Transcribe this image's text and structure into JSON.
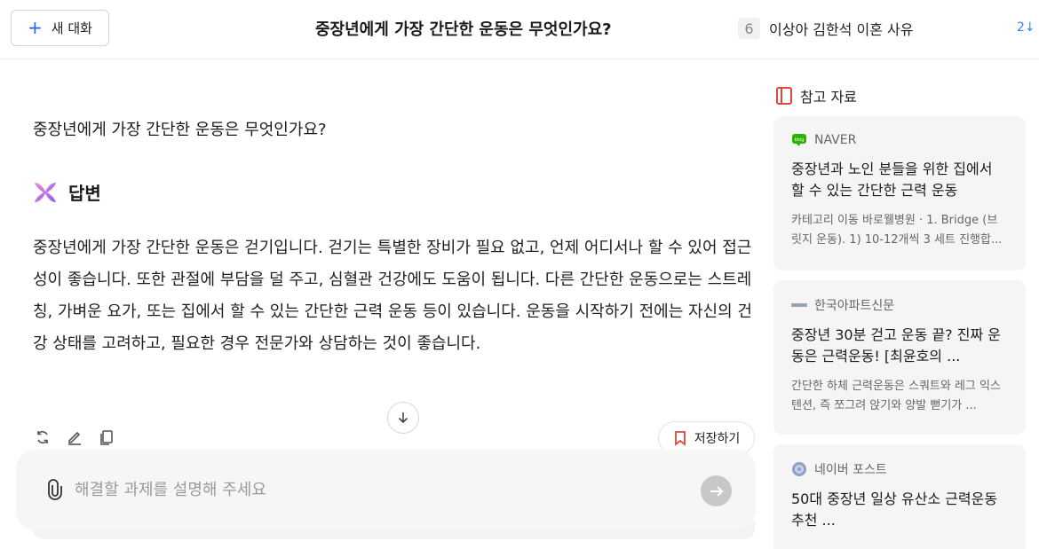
{
  "header": {
    "new_chat_label": "새 대화",
    "title": "중장년에게 가장 간단한 운동은 무엇인가요?",
    "trending": {
      "rank": "6",
      "text": "이상아 김한석 이혼 사유",
      "change": "2↓"
    }
  },
  "conversation": {
    "question": "중장년에게 가장 간단한 운동은 무엇인가요?",
    "answer_title": "답변",
    "answer_body": "중장년에게 가장 간단한 운동은 걷기입니다. 걷기는 특별한 장비가 필요 없고, 언제 어디서나 할 수 있어 접근성이 좋습니다. 또한 관절에 부담을 덜 주고, 심혈관 건강에도 도움이 됩니다. 다른 간단한 운동으로는 스트레칭, 가벼운 요가, 또는 집에서 할 수 있는 간단한 근력 운동 등이 있습니다. 운동을 시작하기 전에는 자신의 건강 상태를 고려하고, 필요한 경우 전문가와 상담하는 것이 좋습니다.",
    "save_label": "저장하기"
  },
  "input": {
    "placeholder": "해결할 과제를 설명해 주세요",
    "value": ""
  },
  "references": {
    "title": "참고 자료",
    "items": [
      {
        "source": "NAVER",
        "title": "중장년과 노인 분들을 위한 집에서 할 수 있는 간단한 근력 운동",
        "desc": "카테고리 이동 바로웰병원 · 1. Bridge (브릿지 운동). 1) 10-12개씩 3 세트 진행합..."
      },
      {
        "source": "한국아파트신문",
        "title": "중장년 30분 걷고 운동 끝? 진짜 운동은 근력운동! [최윤호의 ...",
        "desc": "간단한 하체 근력운동은 스쿼트와 레그 익스텐션, 즉 쪼그려 앉기와 양발 뻗기가 ..."
      },
      {
        "source": "네이버 포스트",
        "title": "50대 중장년 일상 유산소 근력운동 추천 ...",
        "desc": ""
      }
    ]
  },
  "colors": {
    "accent": "#2563eb",
    "bookmark": "#e0443b",
    "card_bg": "#f5f5f5",
    "input_bg": "#f6f6f4"
  }
}
